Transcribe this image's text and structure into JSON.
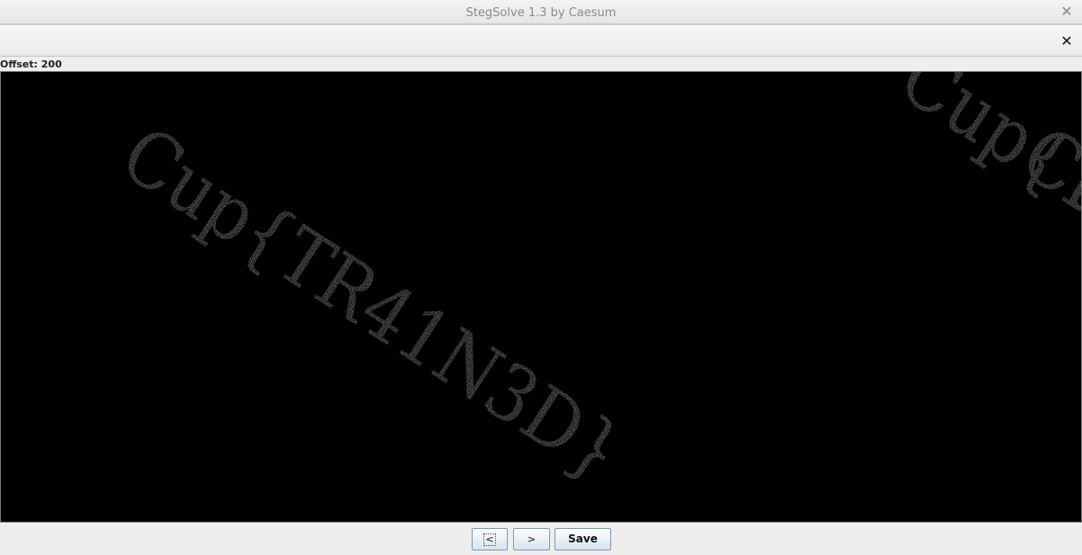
{
  "window": {
    "title": "StegSolve 1.3 by Caesum",
    "close_glyph": "✕"
  },
  "panel": {
    "close_glyph": "✕"
  },
  "offset": {
    "label": "Offset: 200"
  },
  "viewer": {
    "image_text": "Cup{TR41N3D}",
    "background_color": "#000000",
    "text_color": "#cfcfcf"
  },
  "buttons": {
    "prev": "<",
    "next": ">",
    "save": "Save"
  }
}
